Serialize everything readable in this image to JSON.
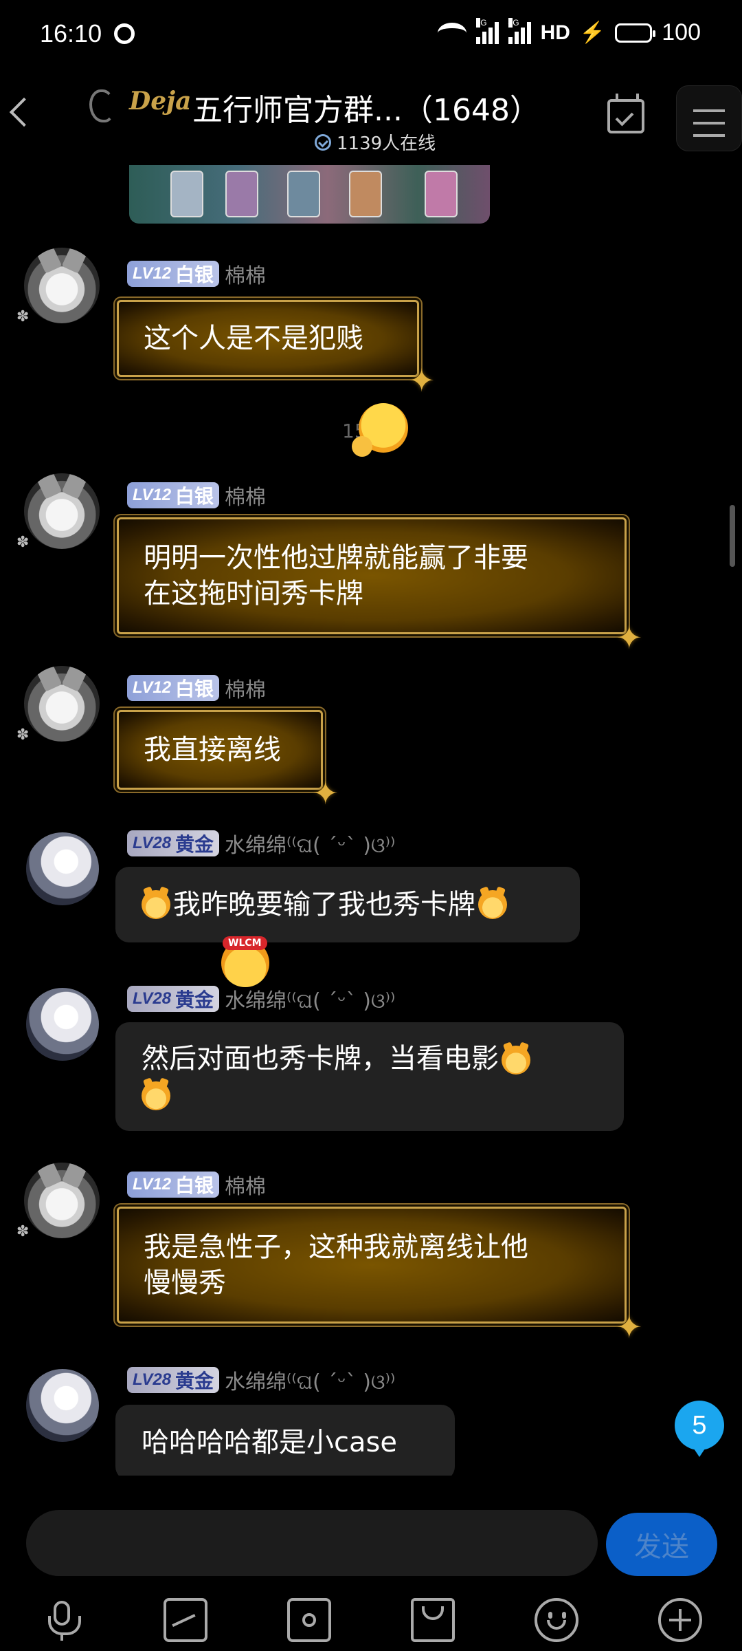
{
  "status_bar": {
    "time": "16:10",
    "network_5g": "5G",
    "network_4g": "4G",
    "hd": "HD",
    "battery": "100"
  },
  "header": {
    "logo_text": "Deja",
    "title": "五行师官方群...（1648）",
    "online": "1139人在线"
  },
  "messages": [
    {
      "sender": "棉棉",
      "level": "LV12",
      "rank": "白银",
      "text": "这个人是不是犯贱"
    },
    {
      "sender": "棉棉",
      "level": "LV12",
      "rank": "白银",
      "text_line1": "明明一次性他过牌就能赢了非要",
      "text_line2": "在这拖时间秀卡牌"
    },
    {
      "sender": "棉棉",
      "level": "LV12",
      "rank": "白银",
      "text": "我直接离线"
    },
    {
      "sender": "水绵绵⁽⁽ଘ( ˊᵕˋ )ଓ⁾⁾",
      "level": "LV28",
      "rank": "黄金",
      "text": "我昨晚要输了我也秀卡牌"
    },
    {
      "sender": "水绵绵⁽⁽ଘ( ˊᵕˋ )ଓ⁾⁾",
      "level": "LV28",
      "rank": "黄金",
      "text": "然后对面也秀卡牌，当看电影"
    },
    {
      "sender": "棉棉",
      "level": "LV12",
      "rank": "白银",
      "text_line1": "我是急性子，这种我就离线让他",
      "text_line2": "慢慢秀"
    },
    {
      "sender": "水绵绵⁽⁽ଘ( ˊᵕˋ )ଓ⁾⁾",
      "level": "LV28",
      "rank": "黄金",
      "text": "哈哈哈哈都是小case"
    }
  ],
  "time_hint": "15",
  "wlcm_label": "WLCM",
  "unread_count": "5",
  "input": {
    "placeholder": "",
    "send_label": "发送"
  }
}
